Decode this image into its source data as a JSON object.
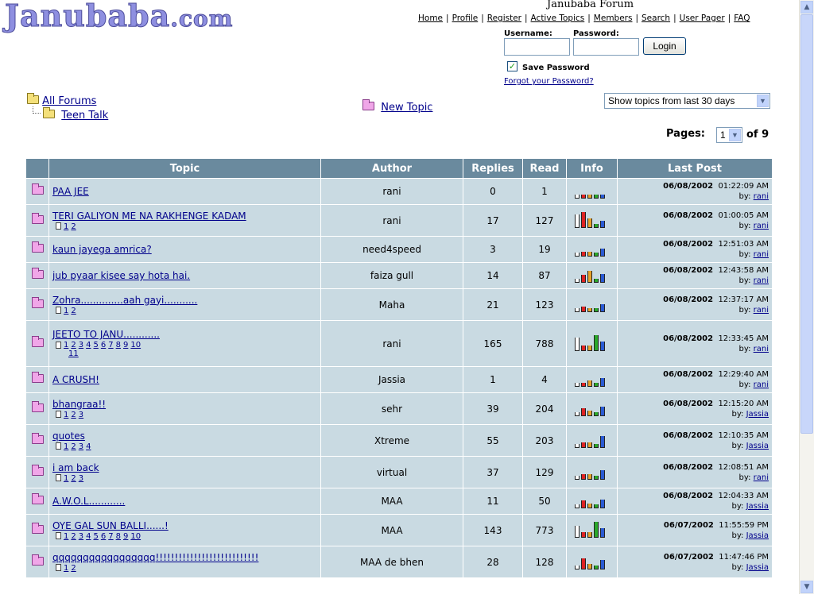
{
  "site": {
    "logo": "Janubaba",
    "logo_suffix": ".com",
    "forum_title": "Janubaba Forum"
  },
  "nav": [
    "Home",
    "Profile",
    "Register",
    "Active Topics",
    "Members",
    "Search",
    "User Pager",
    "FAQ"
  ],
  "login": {
    "username_label": "Username:",
    "password_label": "Password:",
    "button": "Login",
    "save_password": "Save Password",
    "forgot": "Forgot your Password?",
    "save_checked": "✓"
  },
  "breadcrumb": {
    "all_forums": "All Forums",
    "forum": "Teen Talk"
  },
  "new_topic": "New Topic",
  "filter": {
    "selected": "Show topics from last 30 days"
  },
  "pagination": {
    "label": "Pages:",
    "current": "1",
    "of": "of 9"
  },
  "columns": {
    "topic": "Topic",
    "author": "Author",
    "replies": "Replies",
    "read": "Read",
    "info": "Info",
    "last_post": "Last Post"
  },
  "topics": [
    {
      "title": "PAA JEE",
      "pages": [],
      "author": "rani",
      "replies": "0",
      "read": "1",
      "date": "06/08/2002",
      "time": "01:22:09 AM",
      "by": "rani",
      "bars": [
        1,
        1,
        1,
        1,
        1
      ]
    },
    {
      "title": "TERI GALIYON ME NA RAKHENGE KADAM",
      "pages": [
        "1",
        "2"
      ],
      "author": "rani",
      "replies": "17",
      "read": "127",
      "date": "06/08/2002",
      "time": "01:00:05 AM",
      "by": "rani",
      "bars": [
        8,
        10,
        5,
        1,
        3
      ]
    },
    {
      "title": "kaun jayega amrica?",
      "pages": [],
      "author": "need4speed",
      "replies": "3",
      "read": "19",
      "date": "06/08/2002",
      "time": "12:51:03 AM",
      "by": "rani",
      "bars": [
        1,
        2,
        2,
        1,
        4
      ]
    },
    {
      "title": "jub pyaar kisee say hota hai.",
      "pages": [],
      "author": "faiza gull",
      "replies": "14",
      "read": "87",
      "date": "06/08/2002",
      "time": "12:43:58 AM",
      "by": "rani",
      "bars": [
        1,
        4,
        7,
        1,
        5
      ]
    },
    {
      "title": "Zohra..............aah gayi...........",
      "pages": [
        "1",
        "2"
      ],
      "author": "Maha",
      "replies": "21",
      "read": "123",
      "date": "06/08/2002",
      "time": "12:37:17 AM",
      "by": "rani",
      "bars": [
        1,
        2,
        1,
        1,
        4
      ]
    },
    {
      "title": "JEETO TO JANU............",
      "pages": [
        "1",
        "2",
        "3",
        "4",
        "5",
        "6",
        "7",
        "8",
        "9",
        "10",
        "11"
      ],
      "author": "rani",
      "replies": "165",
      "read": "788",
      "date": "06/08/2002",
      "time": "12:33:45 AM",
      "by": "rani",
      "bars": [
        8,
        2,
        2,
        10,
        5
      ]
    },
    {
      "title": "A CRUSH!",
      "pages": [],
      "author": "Jassia",
      "replies": "1",
      "read": "4",
      "date": "06/08/2002",
      "time": "12:29:40 AM",
      "by": "rani",
      "bars": [
        1,
        1,
        3,
        1,
        5
      ]
    },
    {
      "title": "bhangraa!!",
      "pages": [
        "1",
        "2",
        "3"
      ],
      "author": "sehr",
      "replies": "39",
      "read": "204",
      "date": "06/08/2002",
      "time": "12:15:20 AM",
      "by": "Jassia",
      "bars": [
        1,
        4,
        2,
        1,
        5
      ]
    },
    {
      "title": "quotes",
      "pages": [
        "1",
        "2",
        "3",
        "4"
      ],
      "author": "Xtreme",
      "replies": "55",
      "read": "203",
      "date": "06/08/2002",
      "time": "12:10:35 AM",
      "by": "Jassia",
      "bars": [
        1,
        2,
        2,
        1,
        7
      ]
    },
    {
      "title": "i am back",
      "pages": [
        "1",
        "2",
        "3"
      ],
      "author": "virtual",
      "replies": "37",
      "read": "129",
      "date": "06/08/2002",
      "time": "12:08:51 AM",
      "by": "rani",
      "bars": [
        1,
        2,
        2,
        1,
        5
      ]
    },
    {
      "title": "A.W.O.L............",
      "pages": [],
      "author": "MAA",
      "replies": "11",
      "read": "50",
      "date": "06/08/2002",
      "time": "12:04:33 AM",
      "by": "Jassia",
      "bars": [
        1,
        4,
        2,
        1,
        5
      ]
    },
    {
      "title": "OYE GAL SUN BALLI......!",
      "pages": [
        "1",
        "2",
        "3",
        "4",
        "5",
        "6",
        "7",
        "8",
        "9",
        "10"
      ],
      "author": "MAA",
      "replies": "143",
      "read": "773",
      "date": "06/07/2002",
      "time": "11:55:59 PM",
      "by": "Jassia",
      "bars": [
        7,
        2,
        2,
        10,
        5
      ]
    },
    {
      "title": "qqqqqqqqqqqqqqqqq!!!!!!!!!!!!!!!!!!!!!!!!!!!",
      "pages": [
        "1",
        "2"
      ],
      "author": "MAA de bhen",
      "replies": "28",
      "read": "128",
      "date": "06/07/2002",
      "time": "11:47:46 PM",
      "by": "Jassia",
      "bars": [
        1,
        6,
        2,
        1,
        5
      ]
    }
  ],
  "icons": {
    "folder": "folder-icon",
    "topic_folder": "pink-folder-icon",
    "doc": "document-icon",
    "scroll_up": "▲",
    "scroll_down": "▼",
    "dropdown": "▼"
  }
}
